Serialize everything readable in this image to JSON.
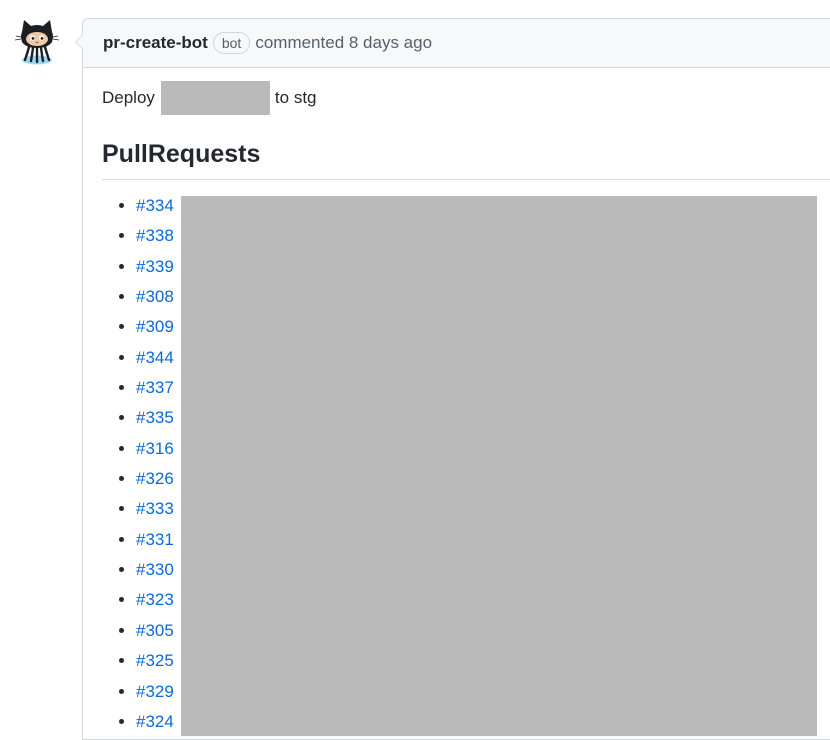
{
  "comment": {
    "author": "pr-create-bot",
    "badge": "bot",
    "action_time": "commented 8 days ago",
    "body": {
      "deploy_prefix": "Deploy",
      "deploy_suffix": "to stg",
      "heading": "PullRequests",
      "pull_requests": [
        "#334",
        "#338",
        "#339",
        "#308",
        "#309",
        "#344",
        "#337",
        "#335",
        "#316",
        "#326",
        "#333",
        "#331",
        "#330",
        "#323",
        "#305",
        "#325",
        "#329",
        "#324"
      ]
    }
  },
  "colors": {
    "link": "#0969da",
    "redaction": "#bababa",
    "header_bg": "#f6f8fa",
    "border": "#d0d7de"
  },
  "icons": {
    "avatar": "octocat-icon"
  }
}
